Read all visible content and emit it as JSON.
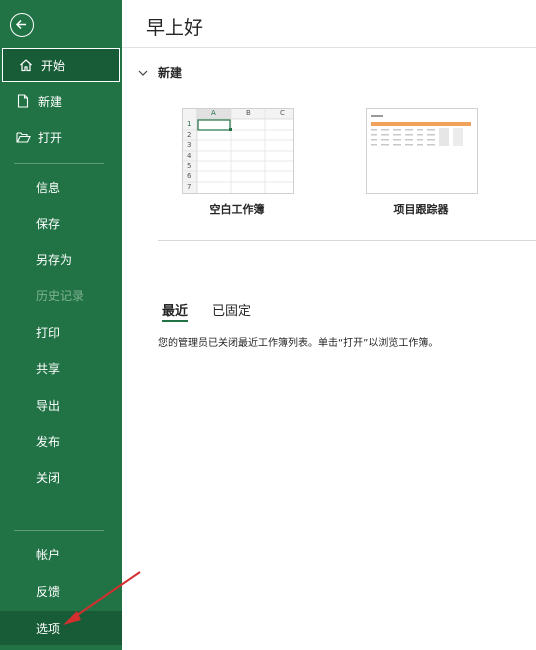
{
  "sidebar": {
    "back_icon": "arrow-left-icon",
    "items": [
      {
        "label": "开始",
        "icon": "home-icon"
      },
      {
        "label": "新建",
        "icon": "new-file-icon"
      },
      {
        "label": "打开",
        "icon": "open-folder-icon"
      },
      {
        "label": "信息"
      },
      {
        "label": "保存"
      },
      {
        "label": "另存为"
      },
      {
        "label": "历史记录"
      },
      {
        "label": "打印"
      },
      {
        "label": "共享"
      },
      {
        "label": "导出"
      },
      {
        "label": "发布"
      },
      {
        "label": "关闭"
      }
    ],
    "bottom_items": [
      {
        "label": "帐户"
      },
      {
        "label": "反馈"
      },
      {
        "label": "选项"
      }
    ]
  },
  "main": {
    "greeting": "早上好",
    "new_section": {
      "title": "新建"
    },
    "templates": [
      {
        "label": "空白工作簿",
        "columns": [
          "A",
          "B",
          "C"
        ],
        "rows": [
          "1",
          "2",
          "3",
          "4",
          "5",
          "6",
          "7"
        ]
      },
      {
        "label": "项目跟踪器"
      }
    ],
    "tabs": [
      {
        "label": "最近"
      },
      {
        "label": "已固定"
      }
    ],
    "notice": "您的管理员已关闭最近工作簿列表。单击“打开”以浏览工作簿。"
  },
  "colors": {
    "accent": "#217346",
    "active": "#185c37",
    "disabled": "#7fb393",
    "annotation": "#d32f2f"
  }
}
